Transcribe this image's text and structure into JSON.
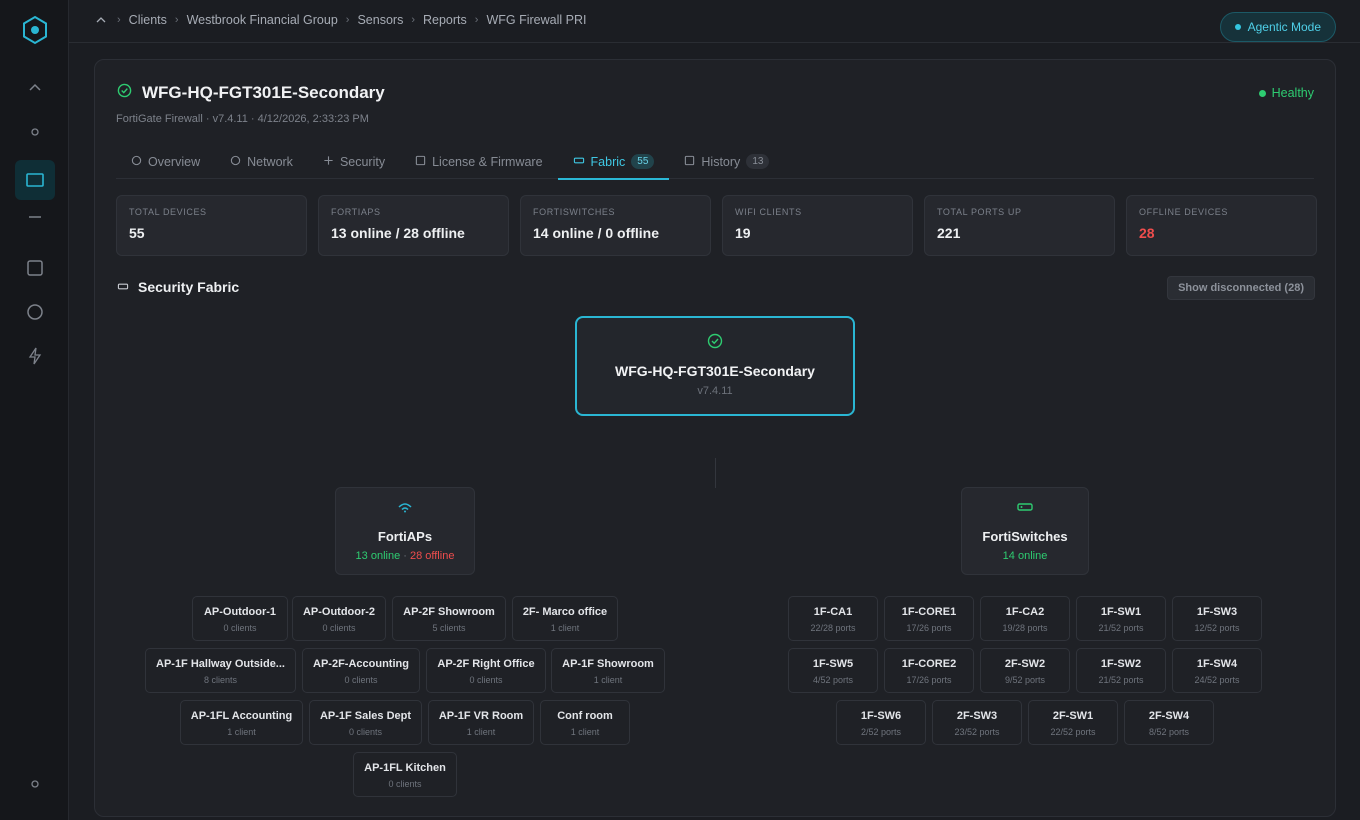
{
  "sidebar": {
    "icons": [
      "logo-icon",
      "chevron-up-icon",
      "dot-icon",
      "monitor-icon",
      "dash-icon",
      "square-icon",
      "circle-icon",
      "bolt-icon",
      "dot-icon"
    ]
  },
  "breadcrumb": [
    "Clients",
    "Westbrook Financial Group",
    "Sensors",
    "Reports",
    "WFG Firewall PRI"
  ],
  "agentic_mode": "Agentic Mode",
  "device": {
    "name": "WFG-HQ-FGT301E-Secondary",
    "subtitle": "FortiGate Firewall · v7.4.11 · 4/12/2026, 2:33:23 PM",
    "status": "Healthy"
  },
  "tabs": [
    {
      "label": "Overview",
      "count": ""
    },
    {
      "label": "Network",
      "count": ""
    },
    {
      "label": "Security",
      "count": ""
    },
    {
      "label": "License & Firmware",
      "count": ""
    },
    {
      "label": "Fabric",
      "count": "55"
    },
    {
      "label": "History",
      "count": "13"
    }
  ],
  "stats": [
    {
      "label": "TOTAL DEVICES",
      "value": "55"
    },
    {
      "label": "FORTIAPS",
      "value": "13 online / 28 offline"
    },
    {
      "label": "FORTISWITCHES",
      "value": "14 online / 0 offline"
    },
    {
      "label": "WIFI CLIENTS",
      "value": "19"
    },
    {
      "label": "TOTAL PORTS UP",
      "value": "221"
    },
    {
      "label": "OFFLINE DEVICES",
      "value": "28"
    }
  ],
  "fabric": {
    "title": "Security Fabric",
    "show_disconnected": "Show disconnected (28)",
    "root": {
      "name": "WFG-HQ-FGT301E-Secondary",
      "version": "v7.4.11"
    },
    "fortiaps": {
      "name": "FortiAPs",
      "online": "13 online",
      "sep": " · ",
      "offline": "28 offline",
      "items": [
        {
          "name": "AP-Outdoor-1",
          "sub": "0 clients"
        },
        {
          "name": "AP-Outdoor-2",
          "sub": "0 clients"
        },
        {
          "name": "AP-2F Showroom",
          "sub": "5 clients"
        },
        {
          "name": "2F- Marco office",
          "sub": "1 client"
        },
        {
          "name": "AP-1F Hallway Outside...",
          "sub": "8 clients"
        },
        {
          "name": "AP-2F-Accounting",
          "sub": "0 clients"
        },
        {
          "name": "AP-2F Right Office",
          "sub": "0 clients"
        },
        {
          "name": "AP-1F Showroom",
          "sub": "1 client"
        },
        {
          "name": "AP-1FL Accounting",
          "sub": "1 client"
        },
        {
          "name": "AP-1F Sales Dept",
          "sub": "0 clients"
        },
        {
          "name": "AP-1F VR Room",
          "sub": "1 client"
        },
        {
          "name": "Conf room",
          "sub": "1 client"
        },
        {
          "name": "AP-1FL Kitchen",
          "sub": "0 clients"
        }
      ]
    },
    "fortiswitches": {
      "name": "FortiSwitches",
      "online": "14 online",
      "items": [
        {
          "name": "1F-CA1",
          "sub": "22/28 ports"
        },
        {
          "name": "1F-CORE1",
          "sub": "17/26 ports"
        },
        {
          "name": "1F-CA2",
          "sub": "19/28 ports"
        },
        {
          "name": "1F-SW1",
          "sub": "21/52 ports"
        },
        {
          "name": "1F-SW3",
          "sub": "12/52 ports"
        },
        {
          "name": "1F-SW5",
          "sub": "4/52 ports"
        },
        {
          "name": "1F-CORE2",
          "sub": "17/26 ports"
        },
        {
          "name": "2F-SW2",
          "sub": "9/52 ports"
        },
        {
          "name": "1F-SW2",
          "sub": "21/52 ports"
        },
        {
          "name": "1F-SW4",
          "sub": "24/52 ports"
        },
        {
          "name": "1F-SW6",
          "sub": "2/52 ports"
        },
        {
          "name": "2F-SW3",
          "sub": "23/52 ports"
        },
        {
          "name": "2F-SW1",
          "sub": "22/52 ports"
        },
        {
          "name": "2F-SW4",
          "sub": "8/52 ports"
        }
      ]
    }
  }
}
